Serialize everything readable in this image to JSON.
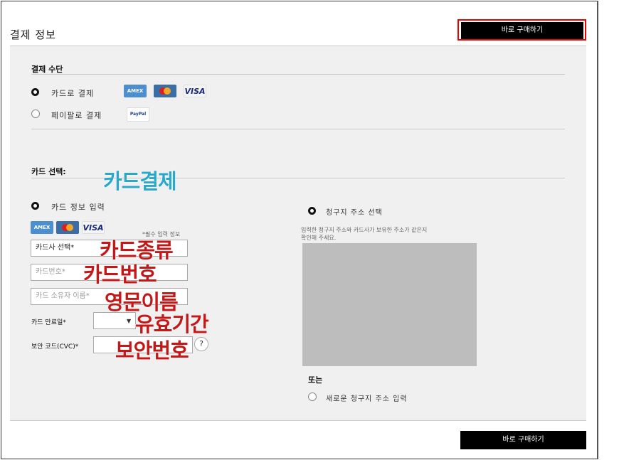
{
  "header": {
    "title": "결제 정보",
    "buy_now_label": "바로 구매하기"
  },
  "payment_method": {
    "heading": "결제 수단",
    "options": [
      {
        "label": "카드로 결제",
        "selected": true
      },
      {
        "label": "페이팔로 결제",
        "selected": false
      }
    ],
    "card_logos": [
      "amex",
      "mastercard",
      "VISA"
    ],
    "paypal_logo": "PayPal"
  },
  "card_select": {
    "heading": "카드 선택:",
    "enter_info_label": "카드 정보 입력",
    "required_note": "*필수 입력 정보",
    "card_company_select": "카드사 선택*",
    "card_number_placeholder": "카드번호*",
    "card_holder_placeholder": "카드 소유자 이름*",
    "expiry_label": "카드 만료일*",
    "cvc_label": "보안 코드(CVC)*",
    "help_glyph": "?"
  },
  "billing": {
    "select_label": "청구지 주소 선택",
    "note_line1": "입력한 청구지 주소와 카드사가 보유한 주소가 같은지",
    "note_line2": "확인해 주세요.",
    "or_label": "또는",
    "new_address_label": "새로운 청구지 주소 입력"
  },
  "annotations": {
    "card_payment": "카드결제",
    "card_type": "카드종류",
    "card_number": "카드번호",
    "english_name": "영문이름",
    "expiry": "유효기간",
    "security_code": "보안번호"
  },
  "colors": {
    "annotation_red": "#c41818",
    "annotation_blue": "#2aa7c9",
    "highlight_outline": "#e00000",
    "button_bg": "#000000"
  }
}
